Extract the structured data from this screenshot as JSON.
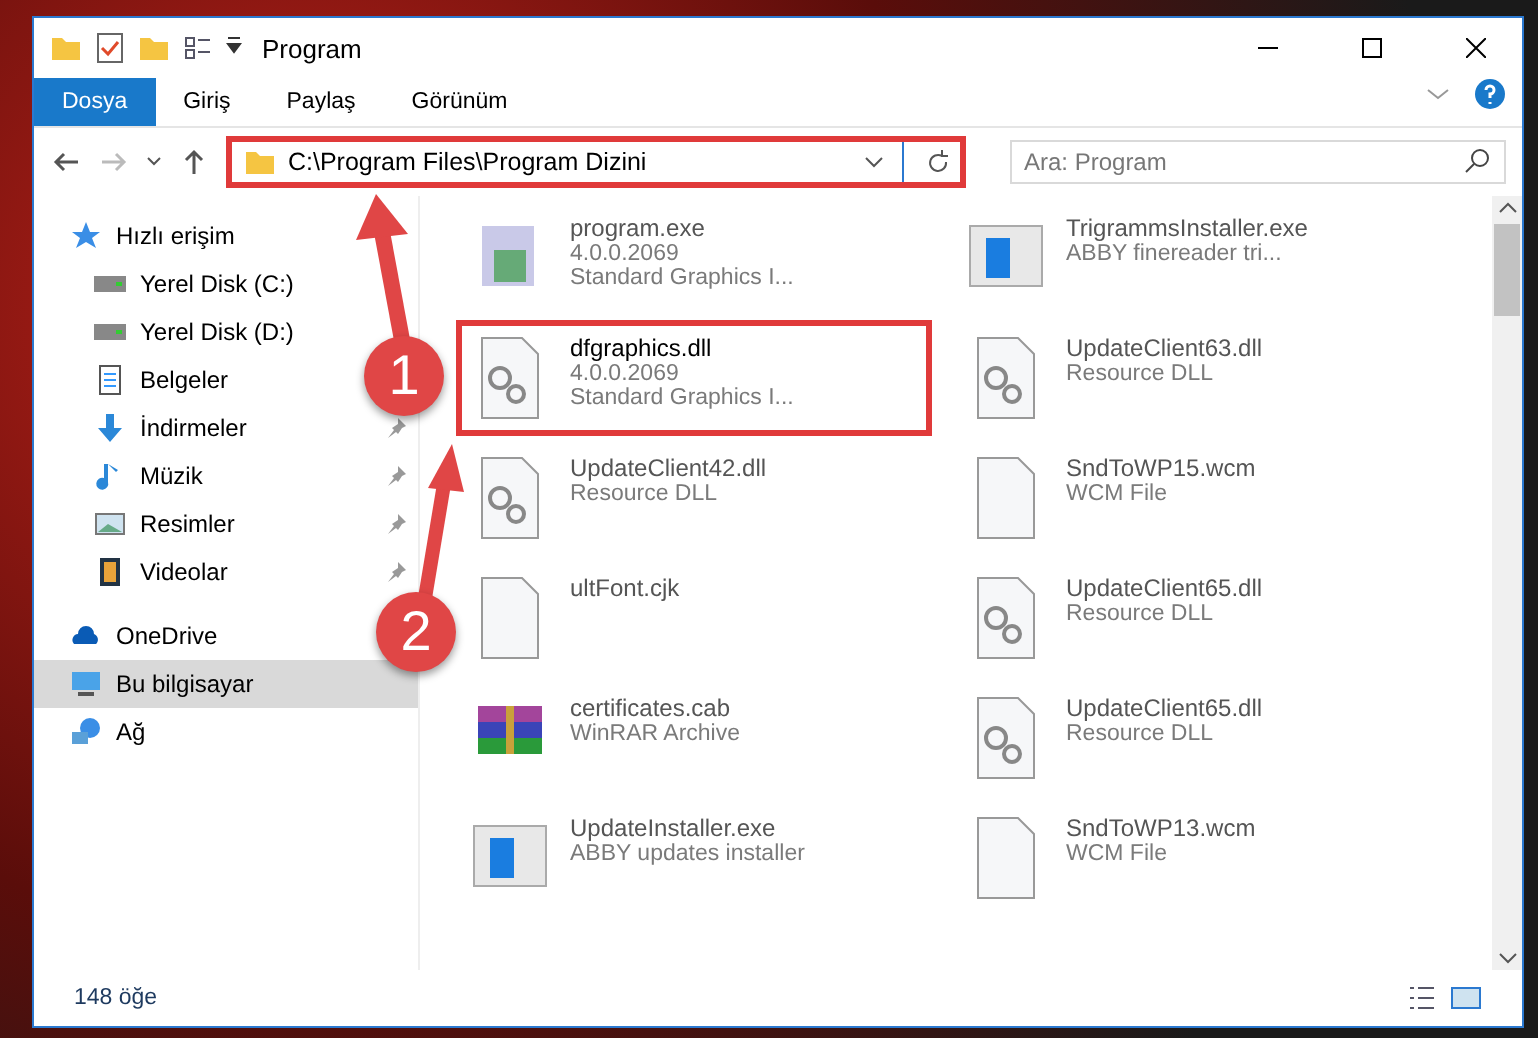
{
  "window": {
    "title": "Program"
  },
  "ribbon_tabs": [
    {
      "label": "Dosya",
      "selected": true
    },
    {
      "label": "Giriş",
      "selected": false
    },
    {
      "label": "Paylaş",
      "selected": false
    },
    {
      "label": "Görünüm",
      "selected": false
    }
  ],
  "address_bar": {
    "path": "C:\\Program Files\\Program Dizini",
    "highlighted": true
  },
  "search": {
    "placeholder": "Ara: Program"
  },
  "sidebar": {
    "items": [
      {
        "label": "Hızlı erişim",
        "kind": "star",
        "selected": false,
        "pinned": false,
        "children": [
          {
            "label": "Yerel Disk (C:)",
            "kind": "drive",
            "selected": false,
            "pinned": false
          },
          {
            "label": "Yerel Disk (D:)",
            "kind": "drive",
            "selected": false,
            "pinned": false
          },
          {
            "label": "Belgeler",
            "kind": "document",
            "selected": false,
            "pinned": false
          },
          {
            "label": "İndirmeler",
            "kind": "download",
            "selected": false,
            "pinned": true
          },
          {
            "label": "Müzik",
            "kind": "music",
            "selected": false,
            "pinned": true
          },
          {
            "label": "Resimler",
            "kind": "picture",
            "selected": false,
            "pinned": true
          },
          {
            "label": "Videolar",
            "kind": "video",
            "selected": false,
            "pinned": true
          }
        ]
      },
      {
        "label": "OneDrive",
        "kind": "cloud",
        "selected": false,
        "pinned": false
      },
      {
        "label": "Bu bilgisayar",
        "kind": "computer",
        "selected": true,
        "pinned": false
      },
      {
        "label": "Ağ",
        "kind": "network",
        "selected": false,
        "pinned": false
      }
    ]
  },
  "files": [
    {
      "name": "program.exe",
      "lines": [
        "4.0.0.2069",
        "Standard Graphics I..."
      ],
      "kind": "app",
      "highlighted": false
    },
    {
      "name": "TrigrammsInstaller.exe",
      "lines": [
        "ABBY finereader tri..."
      ],
      "kind": "installer",
      "highlighted": false
    },
    {
      "name": "dfgraphics.dll",
      "lines": [
        "4.0.0.2069",
        "Standard Graphics I..."
      ],
      "kind": "dll",
      "highlighted": true
    },
    {
      "name": "UpdateClient63.dll",
      "lines": [
        "Resource DLL"
      ],
      "kind": "dll",
      "highlighted": false
    },
    {
      "name": "UpdateClient42.dll",
      "lines": [
        "Resource DLL"
      ],
      "kind": "dll",
      "highlighted": false
    },
    {
      "name": "SndToWP15.wcm",
      "lines": [
        "WCM File"
      ],
      "kind": "file",
      "highlighted": false
    },
    {
      "name": "ultFont.cjk",
      "kind": "file",
      "highlighted": false
    },
    {
      "name": "UpdateClient65.dll",
      "lines": [
        "Resource DLL"
      ],
      "kind": "dll",
      "highlighted": false
    },
    {
      "name": "certificates.cab",
      "lines": [
        "WinRAR Archive"
      ],
      "kind": "archive",
      "highlighted": false
    },
    {
      "name": "UpdateClient65.dll",
      "lines": [
        "Resource DLL"
      ],
      "kind": "dll",
      "highlighted": false
    },
    {
      "name": "UpdateInstaller.exe",
      "lines": [
        "ABBY updates installer"
      ],
      "kind": "installer",
      "highlighted": false
    },
    {
      "name": "SndToWP13.wcm",
      "lines": [
        "WCM File"
      ],
      "kind": "file",
      "highlighted": false
    }
  ],
  "status_bar": {
    "count": "148 öğe"
  },
  "annotations": [
    {
      "number": "1"
    },
    {
      "number": "2"
    }
  ]
}
